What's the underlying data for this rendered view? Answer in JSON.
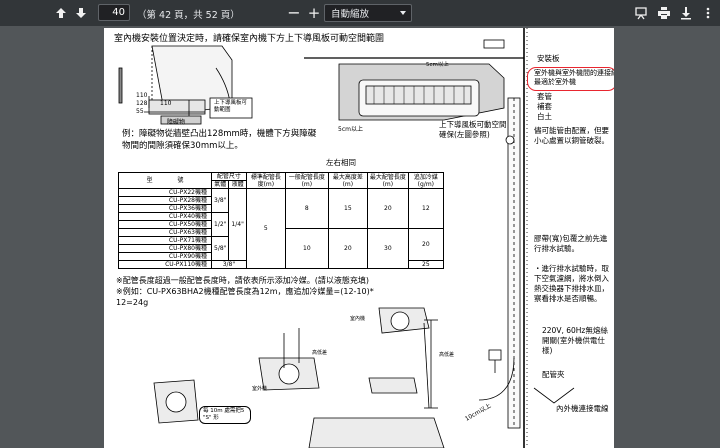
{
  "toolbar": {
    "page_number": "40",
    "page_total": "（第 42 頁，共 52 頁）",
    "zoom_minus": "−",
    "zoom_plus": "+",
    "zoom_mode": "自動縮放"
  },
  "document": {
    "heading": "室內機安裝位置決定時，請確保室內機下方上下導風板可動空間範圍",
    "dimension_values": [
      "110",
      "128",
      "110",
      "55"
    ],
    "obstacle_label": "障礙物",
    "airflow_box_label": "上下導風板可動範圍",
    "example_note": "例：障礙物從牆壁凸出128mm時，機體下方與障礙物間的間隙須確保30mm以上。",
    "install_plate_label": "安裝板",
    "red_note": "室外機與室外機間的連接線最適於室外機",
    "sleeve_label": "套管",
    "putty_label": "補套",
    "white_tape_label": "白土",
    "clearance_label": "5cm以上",
    "clearance_label_2": "5cm以上",
    "louver_label": "上下導風板可動空間確保(左圖參照)",
    "lr_direction_label": "左右相同",
    "pipe_note": "儘可能管由配置，但要小心處置以銅管破裂。",
    "tape_note": "膠帶(寬)包覆之前先進行排水試驗。",
    "drain_note": "・進行排水試驗時，取下空氣濾網，將水倒入熱交換器下排排水皿，察看排水是否順暢。",
    "power_note": "220V, 60Hz無熔絲開關(室外機供電仕樣)",
    "clamp_label": "配管夾",
    "outdoor_cable_label": "內外機連接電線",
    "indoor_unit_label": "室內機",
    "outdoor_unit_label": "室外機",
    "height_label": "高低差",
    "height_label_2": "高低差",
    "note_10m": "每 10m 處需把5 \"S\" 形",
    "wall_distance": "10cm以上",
    "pipe_note_1": "※配管長度超過一般配管長度時，請依表所示添加冷媒。(請以液態充填)",
    "pipe_note_2": "※例如：CU-PX63BHA2機種配管長度為12m，應追加冷媒量=(12-10)* 12=24g",
    "table": {
      "header_model_left": "型",
      "header_model_right": "號",
      "header_pipe_size": "配管尺寸",
      "header_gas": "氣體",
      "header_liquid": "液體",
      "header_std_length": "標準配管長度(m)",
      "header_general_length": "一般配管長度(m)",
      "header_max_height": "最大高度差(m)",
      "header_max_length": "最大配管長度(m)",
      "header_add_refrigerant": "追加冷媒(g/m)",
      "models": [
        "CU-PX22機種",
        "CU-PX28機種",
        "CU-PX36機種",
        "CU-PX40機種",
        "CU-PX50機種",
        "CU-PX63機種",
        "CU-PX71機種",
        "CU-PX80機種",
        "CU-PX90機種",
        "CU-PX110機種"
      ],
      "gas": [
        "3/8\"",
        "1/2\"",
        "5/8\""
      ],
      "gas_110": "3/8\"",
      "liquid": "1/4\"",
      "std_length": "5",
      "general_length": [
        "8",
        "10"
      ],
      "max_height": [
        "15",
        "20"
      ],
      "max_length": [
        "20",
        "30"
      ],
      "add_refrigerant": [
        "12",
        "20",
        "25"
      ]
    }
  }
}
